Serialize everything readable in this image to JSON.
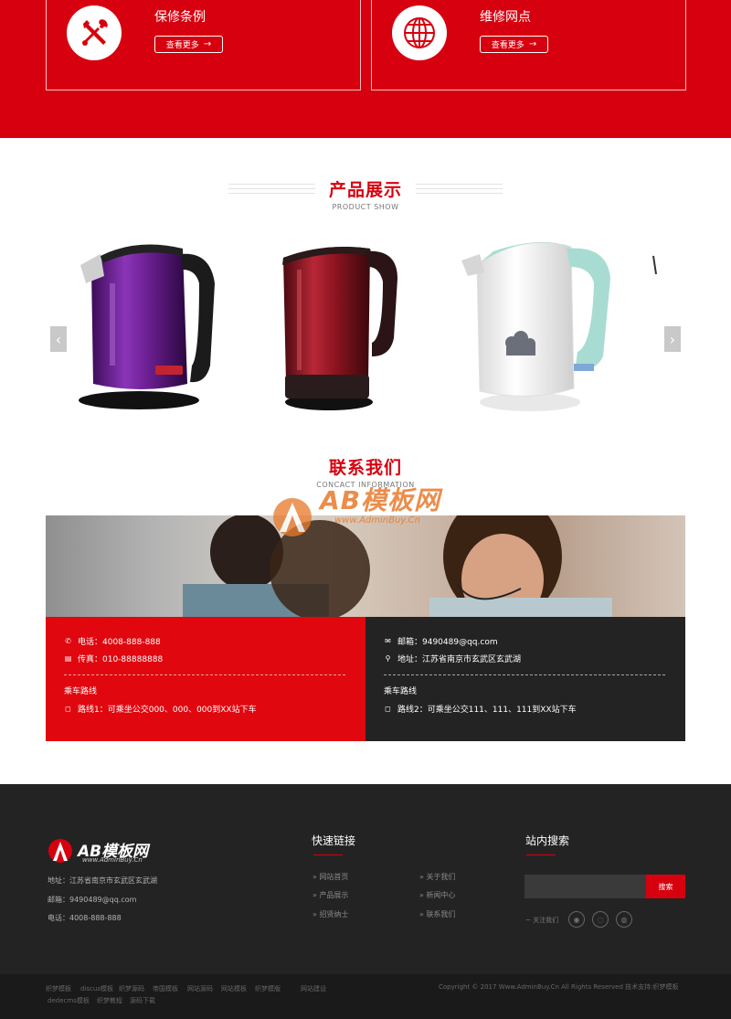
{
  "services": [
    {
      "title": "保修条例",
      "more_label": "查看更多",
      "icon": "tools-icon"
    },
    {
      "title": "维修网点",
      "more_label": "查看更多",
      "icon": "globe-icon"
    }
  ],
  "products_section": {
    "title_cn": "产品展示",
    "title_en": "PRODUCT SHOW",
    "prev": "‹",
    "next": "›"
  },
  "products": [
    {
      "name": "purple-kettle",
      "color": "#6a1e8f"
    },
    {
      "name": "red-kettle",
      "color": "#8c1420"
    },
    {
      "name": "white-kettle",
      "color": "#f2f2f2"
    }
  ],
  "contact_section": {
    "title_cn": "联系我们",
    "title_en": "CONCACT INFORMATION",
    "phone": "电话：4008-888-888",
    "fax": "传真：010-88888888",
    "route_title_1": "乘车路线",
    "route_1": "路线1：可乘坐公交000、000、000到XX站下车",
    "email": "邮箱：9490489@qq.com",
    "address": "地址：江苏省南京市玄武区玄武湖",
    "route_title_2": "乘车路线",
    "route_2": "路线2：可乘坐公交111、111、111到XX站下车"
  },
  "watermark": {
    "text": "AB模板网",
    "sub": "www.AdminBuy.Cn"
  },
  "footer": {
    "logo_text": "AB模板网",
    "logo_sub": "www.AdminBuy.Cn",
    "address": "地址：江苏省南京市玄武区玄武湖",
    "email": "邮箱：9490489@qq.com",
    "phone": "电话：4008-888-888",
    "quick_links_title": "快速链接",
    "quick_links": [
      "网站首页",
      "关于我们",
      "产品展示",
      "新闻中心",
      "招贤纳士",
      "联系我们"
    ],
    "search_title": "站内搜索",
    "search_button": "搜索",
    "search_placeholder": "",
    "follow_label": "关注我们",
    "bottom_links": [
      "织梦模板",
      "discuz模板",
      "织梦源码",
      "帝国模板",
      "网站源码",
      "网站模板",
      "织梦模版",
      "网站建设",
      "dedecms模板",
      "织梦教程",
      "源码下载"
    ],
    "copyright": "Copyright © 2017 Www.AdminBuy.Cn All Rights Reserved   技术支持:织梦模板"
  }
}
